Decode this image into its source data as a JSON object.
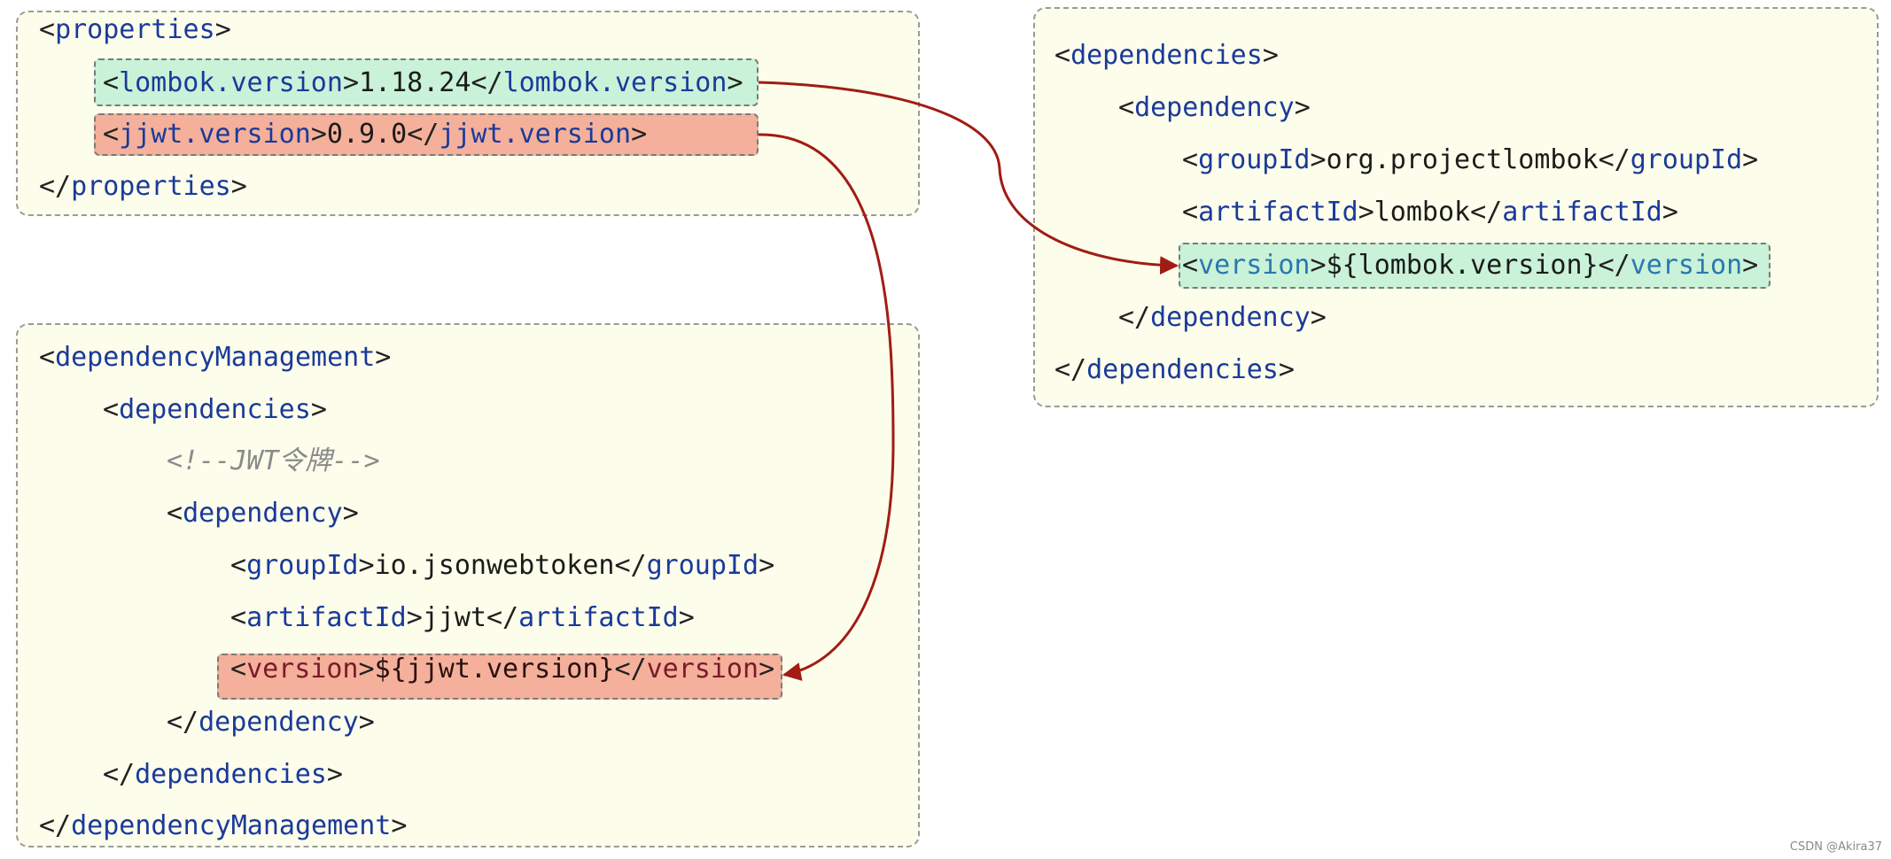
{
  "colors": {
    "panel_bg": "#fdfdeb",
    "tag": "#1a3a9a",
    "highlight_green": "#c9f2d9",
    "highlight_red": "#f4b09a",
    "arrow": "#a01c14"
  },
  "properties_block": {
    "open": "properties",
    "lombok_tag": "lombok.version",
    "lombok_value": "1.18.24",
    "jjwt_tag": "jjwt.version",
    "jjwt_value": "0.9.0",
    "close": "properties"
  },
  "dm_block": {
    "open": "dependencyManagement",
    "deps_open": "dependencies",
    "comment": "<!--JWT令牌-->",
    "dep_open": "dependency",
    "group_tag": "groupId",
    "group_value": "io.jsonwebtoken",
    "artifact_tag": "artifactId",
    "artifact_value": "jjwt",
    "version_tag": "version",
    "version_value": "${jjwt.version}",
    "dep_close": "dependency",
    "deps_close": "dependencies",
    "close": "dependencyManagement"
  },
  "deps_block": {
    "open": "dependencies",
    "dep_open": "dependency",
    "group_tag": "groupId",
    "group_value": "org.projectlombok",
    "artifact_tag": "artifactId",
    "artifact_value": "lombok",
    "version_tag": "version",
    "version_value": "${lombok.version}",
    "dep_close": "dependency",
    "close": "dependencies"
  },
  "credit": "CSDN @Akira37"
}
